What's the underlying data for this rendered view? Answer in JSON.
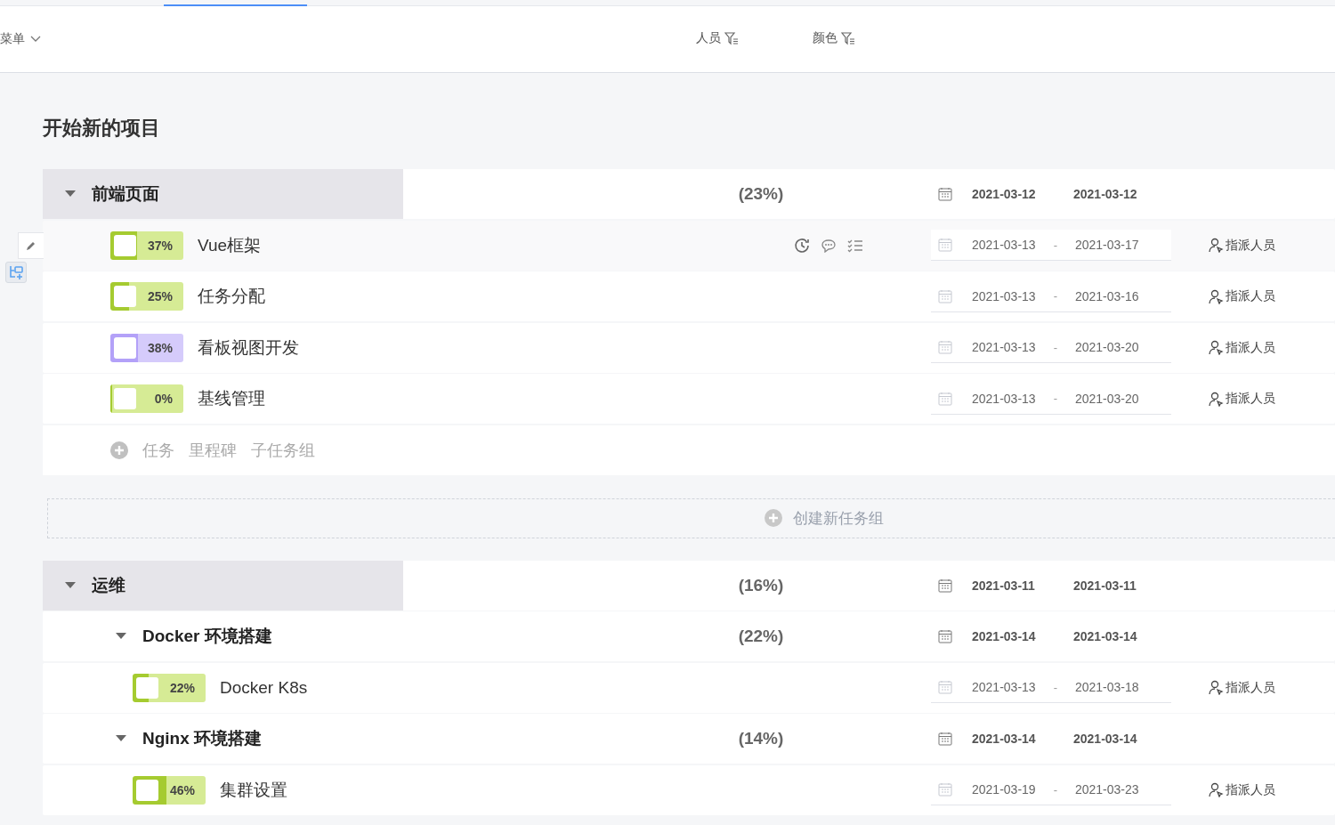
{
  "toolbar": {
    "menu": "菜单",
    "filters": [
      "人员",
      "颜色"
    ]
  },
  "project": {
    "title": "开始新的项目"
  },
  "groups": [
    {
      "title": "前端页面",
      "expanded": true,
      "progress": "(23%)",
      "start": "2021-03-12",
      "end": "2021-03-12",
      "items": [
        {
          "kind": "task",
          "name": "Vue框架",
          "percent": "37%",
          "level": 0.37,
          "color": "#d6eb95",
          "checked": false,
          "hovered": true,
          "start": "2021-03-13",
          "separator": "-",
          "end": "2021-03-17",
          "assign": "指派人员"
        },
        {
          "kind": "task",
          "name": "任务分配",
          "percent": "25%",
          "level": 0.25,
          "color": "#d6eb95",
          "checked": false,
          "hovered": false,
          "start": "2021-03-13",
          "separator": "-",
          "end": "2021-03-16",
          "assign": "指派人员"
        },
        {
          "kind": "task",
          "name": "看板视图开发",
          "percent": "38%",
          "level": 0.38,
          "color": "#d5cbfb",
          "checked": false,
          "hovered": false,
          "start": "2021-03-13",
          "separator": "-",
          "end": "2021-03-20",
          "assign": "指派人员"
        },
        {
          "kind": "task",
          "name": "基线管理",
          "percent": "0%",
          "level": 0,
          "color": "#d6eb95",
          "checked": false,
          "hovered": false,
          "start": "2021-03-13",
          "separator": "-",
          "end": "2021-03-20",
          "assign": "指派人员"
        }
      ],
      "add_actions": [
        "任务",
        "里程碑",
        "子任务组"
      ]
    },
    {
      "title": "运维",
      "expanded": true,
      "progress": "(16%)",
      "start": "2021-03-11",
      "end": "2021-03-11",
      "items": [
        {
          "kind": "subgroup",
          "name": "Docker 环境搭建",
          "expanded": true,
          "progress": "(22%)",
          "start": "2021-03-14",
          "end": "2021-03-14",
          "children": [
            {
              "kind": "task",
              "name": "Docker K8s",
              "percent": "22%",
              "level": 0.22,
              "color": "#d6eb95",
              "checked": false,
              "hovered": false,
              "start": "2021-03-13",
              "separator": "-",
              "end": "2021-03-18",
              "assign": "指派人员"
            }
          ]
        },
        {
          "kind": "subgroup",
          "name": "Nginx 环境搭建",
          "expanded": true,
          "progress": "(14%)",
          "start": "2021-03-14",
          "end": "2021-03-14",
          "children": [
            {
              "kind": "task",
              "name": "集群设置",
              "percent": "46%",
              "level": 0.46,
              "color": "#d6eb95",
              "checked": false,
              "hovered": false,
              "start": "2021-03-19",
              "separator": "-",
              "end": "2021-03-23",
              "assign": "指派人员"
            }
          ]
        }
      ]
    }
  ],
  "create_group": "创建新任务组"
}
